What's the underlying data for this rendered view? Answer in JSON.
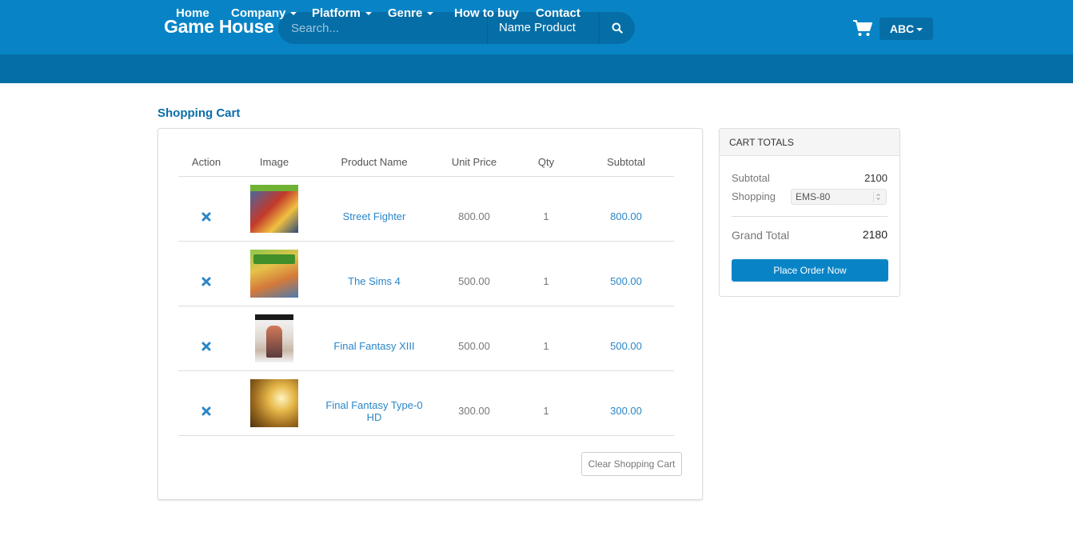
{
  "header": {
    "brand": "Game House",
    "search_placeholder": "Search...",
    "search_category": "Name Product",
    "user_label": "ABC"
  },
  "nav": {
    "items": [
      {
        "label": "Home",
        "dropdown": false
      },
      {
        "label": "Company",
        "dropdown": true
      },
      {
        "label": "Platform",
        "dropdown": true
      },
      {
        "label": "Genre",
        "dropdown": true
      },
      {
        "label": "How to buy",
        "dropdown": false
      },
      {
        "label": "Contact",
        "dropdown": false
      }
    ]
  },
  "page_title": "Shopping Cart",
  "cart": {
    "columns": [
      "Action",
      "Image",
      "Product Name",
      "Unit Price",
      "Qty",
      "Subtotal"
    ],
    "rows": [
      {
        "name": "Street Fighter",
        "unit_price": "800.00",
        "qty": "1",
        "subtotal": "800.00"
      },
      {
        "name": "The Sims 4",
        "unit_price": "500.00",
        "qty": "1",
        "subtotal": "500.00"
      },
      {
        "name": "Final Fantasy XIII",
        "unit_price": "500.00",
        "qty": "1",
        "subtotal": "500.00"
      },
      {
        "name": "Final Fantasy Type-0 HD",
        "unit_price": "300.00",
        "qty": "1",
        "subtotal": "300.00"
      }
    ],
    "clear_label": "Clear Shopping Cart"
  },
  "totals": {
    "title": "CART TOTALS",
    "subtotal_label": "Subtotal",
    "subtotal_value": "2100",
    "shipping_label": "Shopping",
    "shipping_option": "EMS-80",
    "grand_total_label": "Grand Total",
    "grand_total_value": "2180",
    "order_label": "Place Order Now"
  },
  "colors": {
    "brand_blue": "#0884c6",
    "nav_blue": "#066ea6",
    "link_blue": "#2a86c8"
  }
}
